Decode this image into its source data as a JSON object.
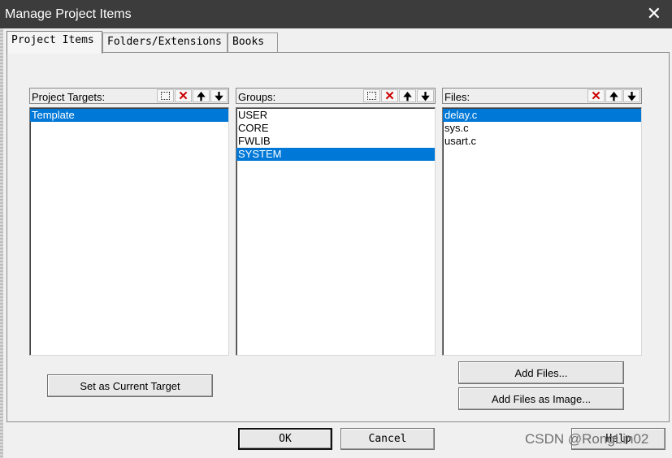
{
  "window": {
    "title": "Manage Project Items",
    "close_glyph": "✕"
  },
  "tabs": [
    {
      "label": "Project Items",
      "active": true
    },
    {
      "label": "Folders/Extensions",
      "active": false
    },
    {
      "label": "Books",
      "active": false
    }
  ],
  "panels": {
    "targets": {
      "label": "Project Targets:",
      "items": [
        "Template"
      ],
      "selected": "Template"
    },
    "groups": {
      "label": "Groups:",
      "items": [
        "USER",
        "CORE",
        "FWLIB",
        "SYSTEM"
      ],
      "selected": "SYSTEM"
    },
    "files": {
      "label": "Files:",
      "items": [
        "delay.c",
        "sys.c",
        "usart.c"
      ],
      "selected": "delay.c"
    }
  },
  "icons": {
    "new": "new-icon",
    "delete": "delete-icon",
    "move_up": "arrow-up-icon",
    "move_down": "arrow-down-icon",
    "delete_glyph": "✕",
    "up_glyph": "🠉",
    "down_glyph": "🠋"
  },
  "buttons": {
    "set_current_target": "Set as Current Target",
    "add_files": "Add Files...",
    "add_files_image": "Add Files as Image...",
    "ok": "OK",
    "cancel": "Cancel",
    "help": "Help"
  },
  "watermark": "CSDN @RongLin02",
  "colors": {
    "title_bar": "#3c3c3c",
    "selection": "#0078d7",
    "dialog_bg": "#f0f0f0"
  }
}
